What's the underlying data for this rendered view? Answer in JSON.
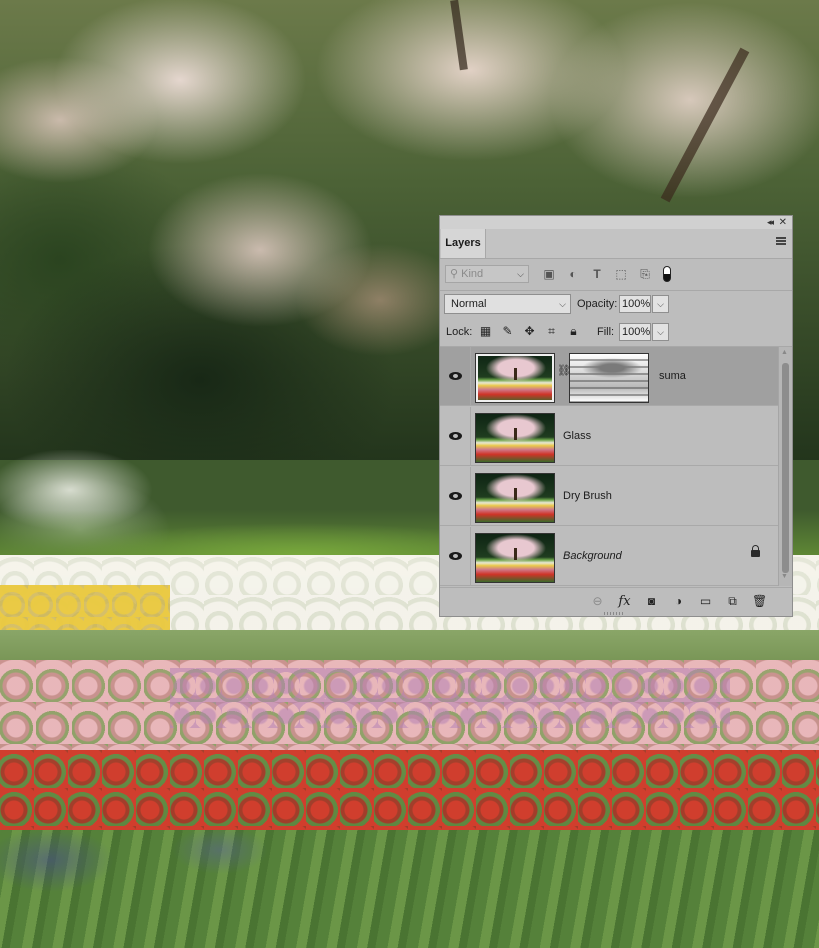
{
  "panel": {
    "tab_label": "Layers",
    "filter_kind_placeholder": "Kind",
    "blend_mode": "Normal",
    "opacity_label": "Opacity:",
    "opacity_value": "100%",
    "lock_label": "Lock:",
    "fill_label": "Fill:",
    "fill_value": "100%",
    "filter_icons": [
      "image-filter-icon",
      "adjustment-filter-icon",
      "type-filter-icon",
      "shape-filter-icon",
      "smart-object-filter-icon",
      "filter-toggle-icon"
    ],
    "lock_icons": [
      "lock-transparent-pixels-icon",
      "lock-image-pixels-icon",
      "lock-position-icon",
      "lock-artboard-icon",
      "lock-all-icon"
    ],
    "bottom_icons": [
      "link-layers-icon",
      "fx-icon",
      "add-mask-icon",
      "adjustment-layer-icon",
      "new-group-icon",
      "new-layer-icon",
      "delete-layer-icon"
    ]
  },
  "layers": [
    {
      "name": "suma",
      "visible": true,
      "selected": true,
      "has_mask": true
    },
    {
      "name": "Glass",
      "visible": true,
      "selected": false
    },
    {
      "name": "Dry Brush",
      "visible": true,
      "selected": false
    },
    {
      "name": "Background",
      "visible": true,
      "selected": false,
      "locked": true,
      "italic": true
    }
  ],
  "colors": {
    "panel_bg": "#bdbdbd",
    "selected_row": "#a0a0a0",
    "divider": "#a9a9a9"
  }
}
